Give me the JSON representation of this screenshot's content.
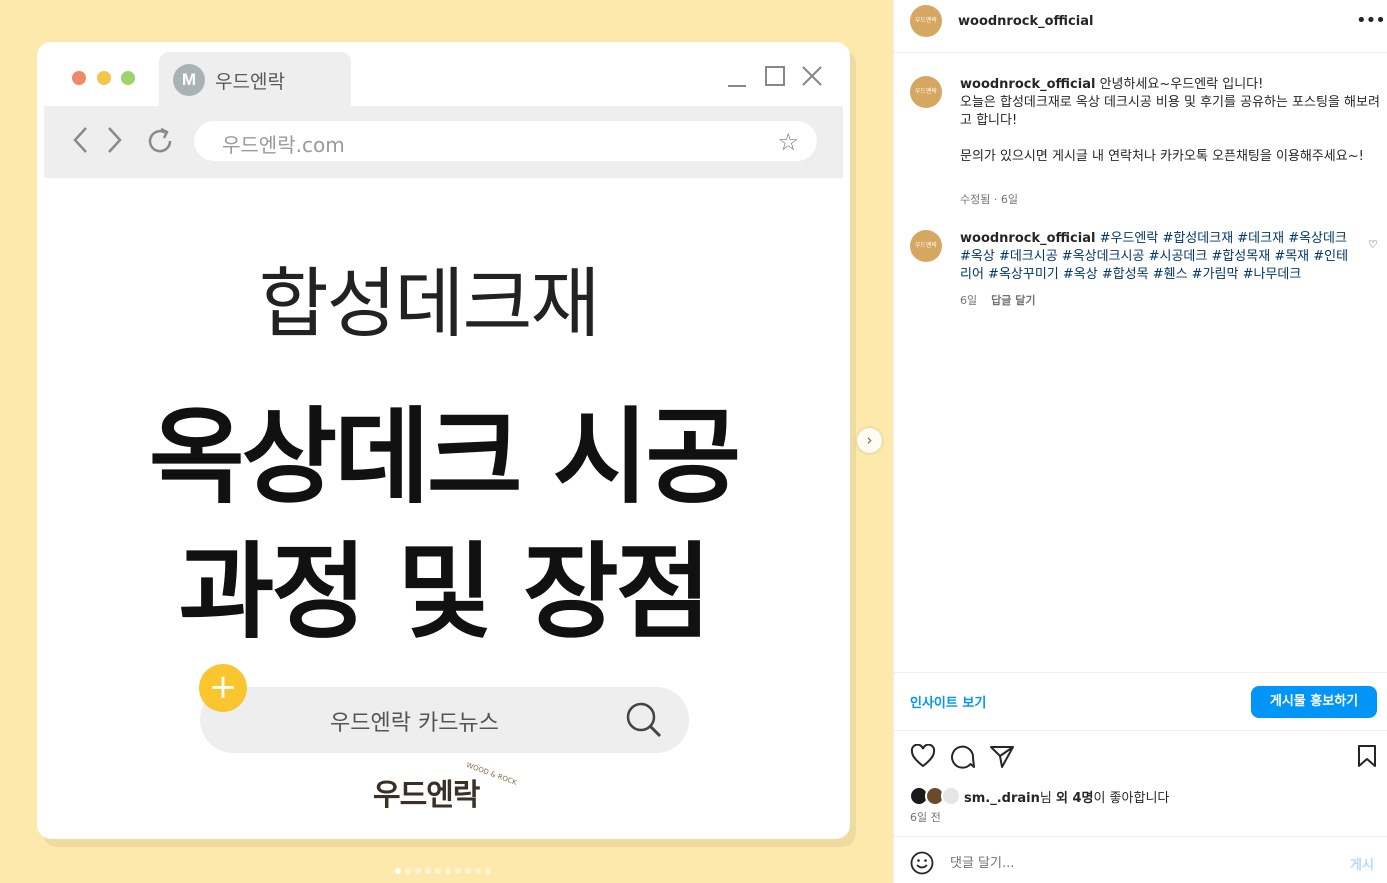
{
  "media": {
    "tab_initial": "M",
    "tab_label": "우드엔락",
    "url": "우드엔락.com",
    "headline_sub": "합성데크재",
    "headline_line1": "옥상데크 시공",
    "headline_line2": "과정 및 장점",
    "search_text": "우드엔락 카드뉴스",
    "brand_logo": "우드엔락",
    "brand_small": "WOOD & ROCK",
    "window_colors": {
      "red": "#f08968",
      "yellow": "#f6c64c",
      "green": "#9dd36b"
    },
    "carousel": {
      "count": 10,
      "active": 1
    }
  },
  "sidebar": {
    "header": {
      "username": "woodnrock_official",
      "avatar_text": "우드엔락"
    },
    "caption": {
      "username": "woodnrock_official",
      "line1": "안녕하세요~우드엔락 입니다!",
      "line2": "오늘은 합성데크재로 옥상 데크시공 비용 및 후기를 공유하는 포스팅을 해보려고 합니다!",
      "line3": "문의가 있으시면 게시글 내 연락처나 카카오톡 오픈채팅을 이용해주세요~!",
      "meta": "수정됨 · 6일"
    },
    "comment": {
      "username": "woodnrock_official",
      "hashtags": "#우드엔락 #합성데크재 #데크재 #옥상데크 #옥상 #데크시공 #옥상데크시공 #시공데크 #합성목재 #목재 #인테리어 #옥상꾸미기 #옥상 #합성목 #휀스 #가림막 #나무데크",
      "time": "6일",
      "reply_label": "답글 달기"
    },
    "insight_label": "인사이트 보기",
    "promote_label": "게시물 홍보하기",
    "likes": {
      "user": "sm._.drain",
      "suffix_1": "님 ",
      "others": "외 4명",
      "suffix_2": "이 좋아합니다"
    },
    "post_time": "6일 전",
    "comment_placeholder": "댓글 달기...",
    "post_label": "게시",
    "accent_color": "#0095f6"
  }
}
